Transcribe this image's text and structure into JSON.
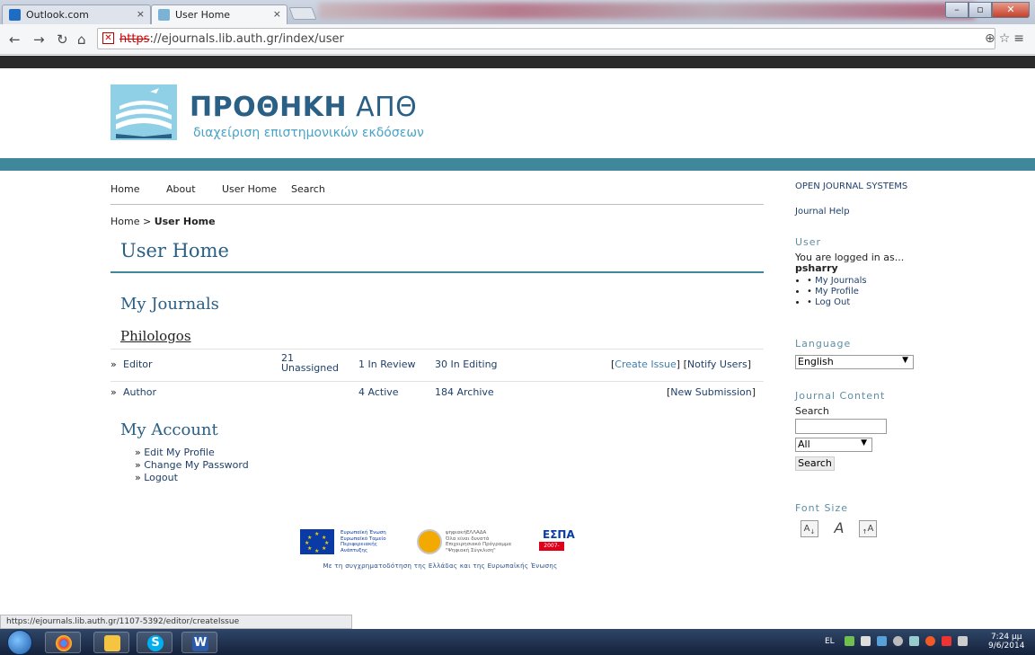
{
  "browser": {
    "tabs": [
      {
        "label": "Outlook.com",
        "close": "×"
      },
      {
        "label": "User Home",
        "close": "×"
      }
    ],
    "url_scheme": "https",
    "url_rest": "://ejournals.lib.auth.gr/index/user"
  },
  "site": {
    "logo_title_bold": "ΠΡΟΘΗΚΗ",
    "logo_title_thin": " ΑΠΘ",
    "logo_subtitle": "διαχείριση επιστημονικών εκδόσεων"
  },
  "nav": {
    "items": [
      "Home",
      "About",
      "User Home",
      "Search"
    ]
  },
  "breadcrumb": {
    "home": "Home",
    "sep": " > ",
    "current": "User Home"
  },
  "page": {
    "title": "User Home",
    "my_journals": "My Journals",
    "journal_name": "Philologos",
    "editor_row": {
      "role": "Editor",
      "prefix": "» ",
      "unassigned_count": "21",
      "unassigned_label": "Unassigned",
      "in_review": "1 In Review",
      "in_editing": "30 In Editing",
      "create_issue": "Create Issue",
      "notify_users": "Notify Users"
    },
    "author_row": {
      "role": "Author",
      "prefix": "» ",
      "active": "4 Active",
      "archive": "184 Archive",
      "new_submission": "New Submission"
    },
    "my_account": "My Account",
    "account_links": [
      "Edit My Profile",
      "Change My Password",
      "Logout"
    ],
    "bullet": "» "
  },
  "sidebar": {
    "ojs": "OPEN JOURNAL SYSTEMS",
    "journal_help": "Journal Help",
    "user_heading": "User",
    "logged_in_as": "You are logged in as...",
    "username": "psharry",
    "user_links": [
      "My Journals",
      "My Profile",
      "Log Out"
    ],
    "language_heading": "Language",
    "language_value": "English",
    "journal_content_heading": "Journal Content",
    "search_label": "Search",
    "search_scope": "All",
    "search_button": "Search",
    "font_size_heading": "Font Size",
    "font_buttons": [
      "A",
      "A",
      "A"
    ]
  },
  "footer": {
    "eu_text": [
      "Ευρωπαϊκή Ένωση",
      "Ευρωπαϊκό Ταμείο",
      "Περιφερειακής",
      "Ανάπτυξης"
    ],
    "dig_text": [
      "ψηφιακήΕΛΛΑΔΑ",
      "Όλα είναι δυνατά",
      "Επιχειρησιακό Πρόγραμμα",
      "\"Ψηφιακή Σύγκλιση\""
    ],
    "espa_title": "ΕΣΠΑ",
    "espa_years": "2007-2013",
    "caption": "Με τη συγχρηματοδότηση της Ελλάδας και της Ευρωπαϊκής Ένωσης"
  },
  "status_url": "https://ejournals.lib.auth.gr/1107-5392/editor/createIssue",
  "taskbar": {
    "lang": "EL",
    "time": "7:24 μμ",
    "date": "9/6/2014"
  },
  "colors": {
    "teal": "#3f889c",
    "title_blue": "#2a5f86",
    "link": "#1e3f6a"
  }
}
